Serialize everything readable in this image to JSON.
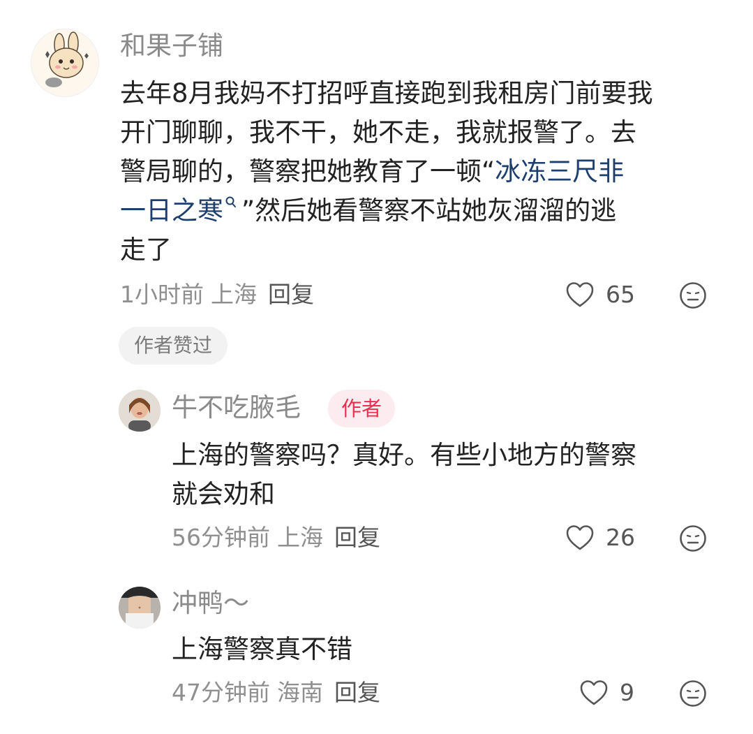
{
  "colors": {
    "username": "#8a8a8a",
    "body_text": "#222222",
    "meta_text": "#8f8f8f",
    "link": "#1e3f6e",
    "author_tag_bg": "#fdecef",
    "author_tag_text": "#e8304f",
    "badge_bg": "#f2f2f2"
  },
  "comments": [
    {
      "username": "和果子铺",
      "avatar_icon": "rabbit-avatar",
      "text_lines": [
        "去年8月我妈不打招呼直接跑到我租房门前要我",
        "开门聊聊，我不干，她不走，我就报警了。去",
        "警局聊的，警察把她教育了一顿“"
      ],
      "link_part1": "冰冻三尺非",
      "link_part2": "一日之寒",
      "after_link": "”然后她看警察不站她灰溜溜的逃",
      "last_line": "走了",
      "time": "1小时前",
      "location": "上海",
      "reply": "回复",
      "likes": "65",
      "badge": "作者赞过"
    },
    {
      "username": "牛不吃腋毛",
      "avatar_icon": "person-avatar",
      "author_tag": "作者",
      "text_lines": [
        "上海的警察吗？真好。有些小地方的警察",
        "就会劝和"
      ],
      "time": "56分钟前",
      "location": "上海",
      "reply": "回复",
      "likes": "26"
    },
    {
      "username": "冲鸭～",
      "avatar_icon": "torso-avatar",
      "text_lines": [
        "上海警察真不错"
      ],
      "time": "47分钟前",
      "location": "海南",
      "reply": "回复",
      "likes": "9"
    }
  ]
}
